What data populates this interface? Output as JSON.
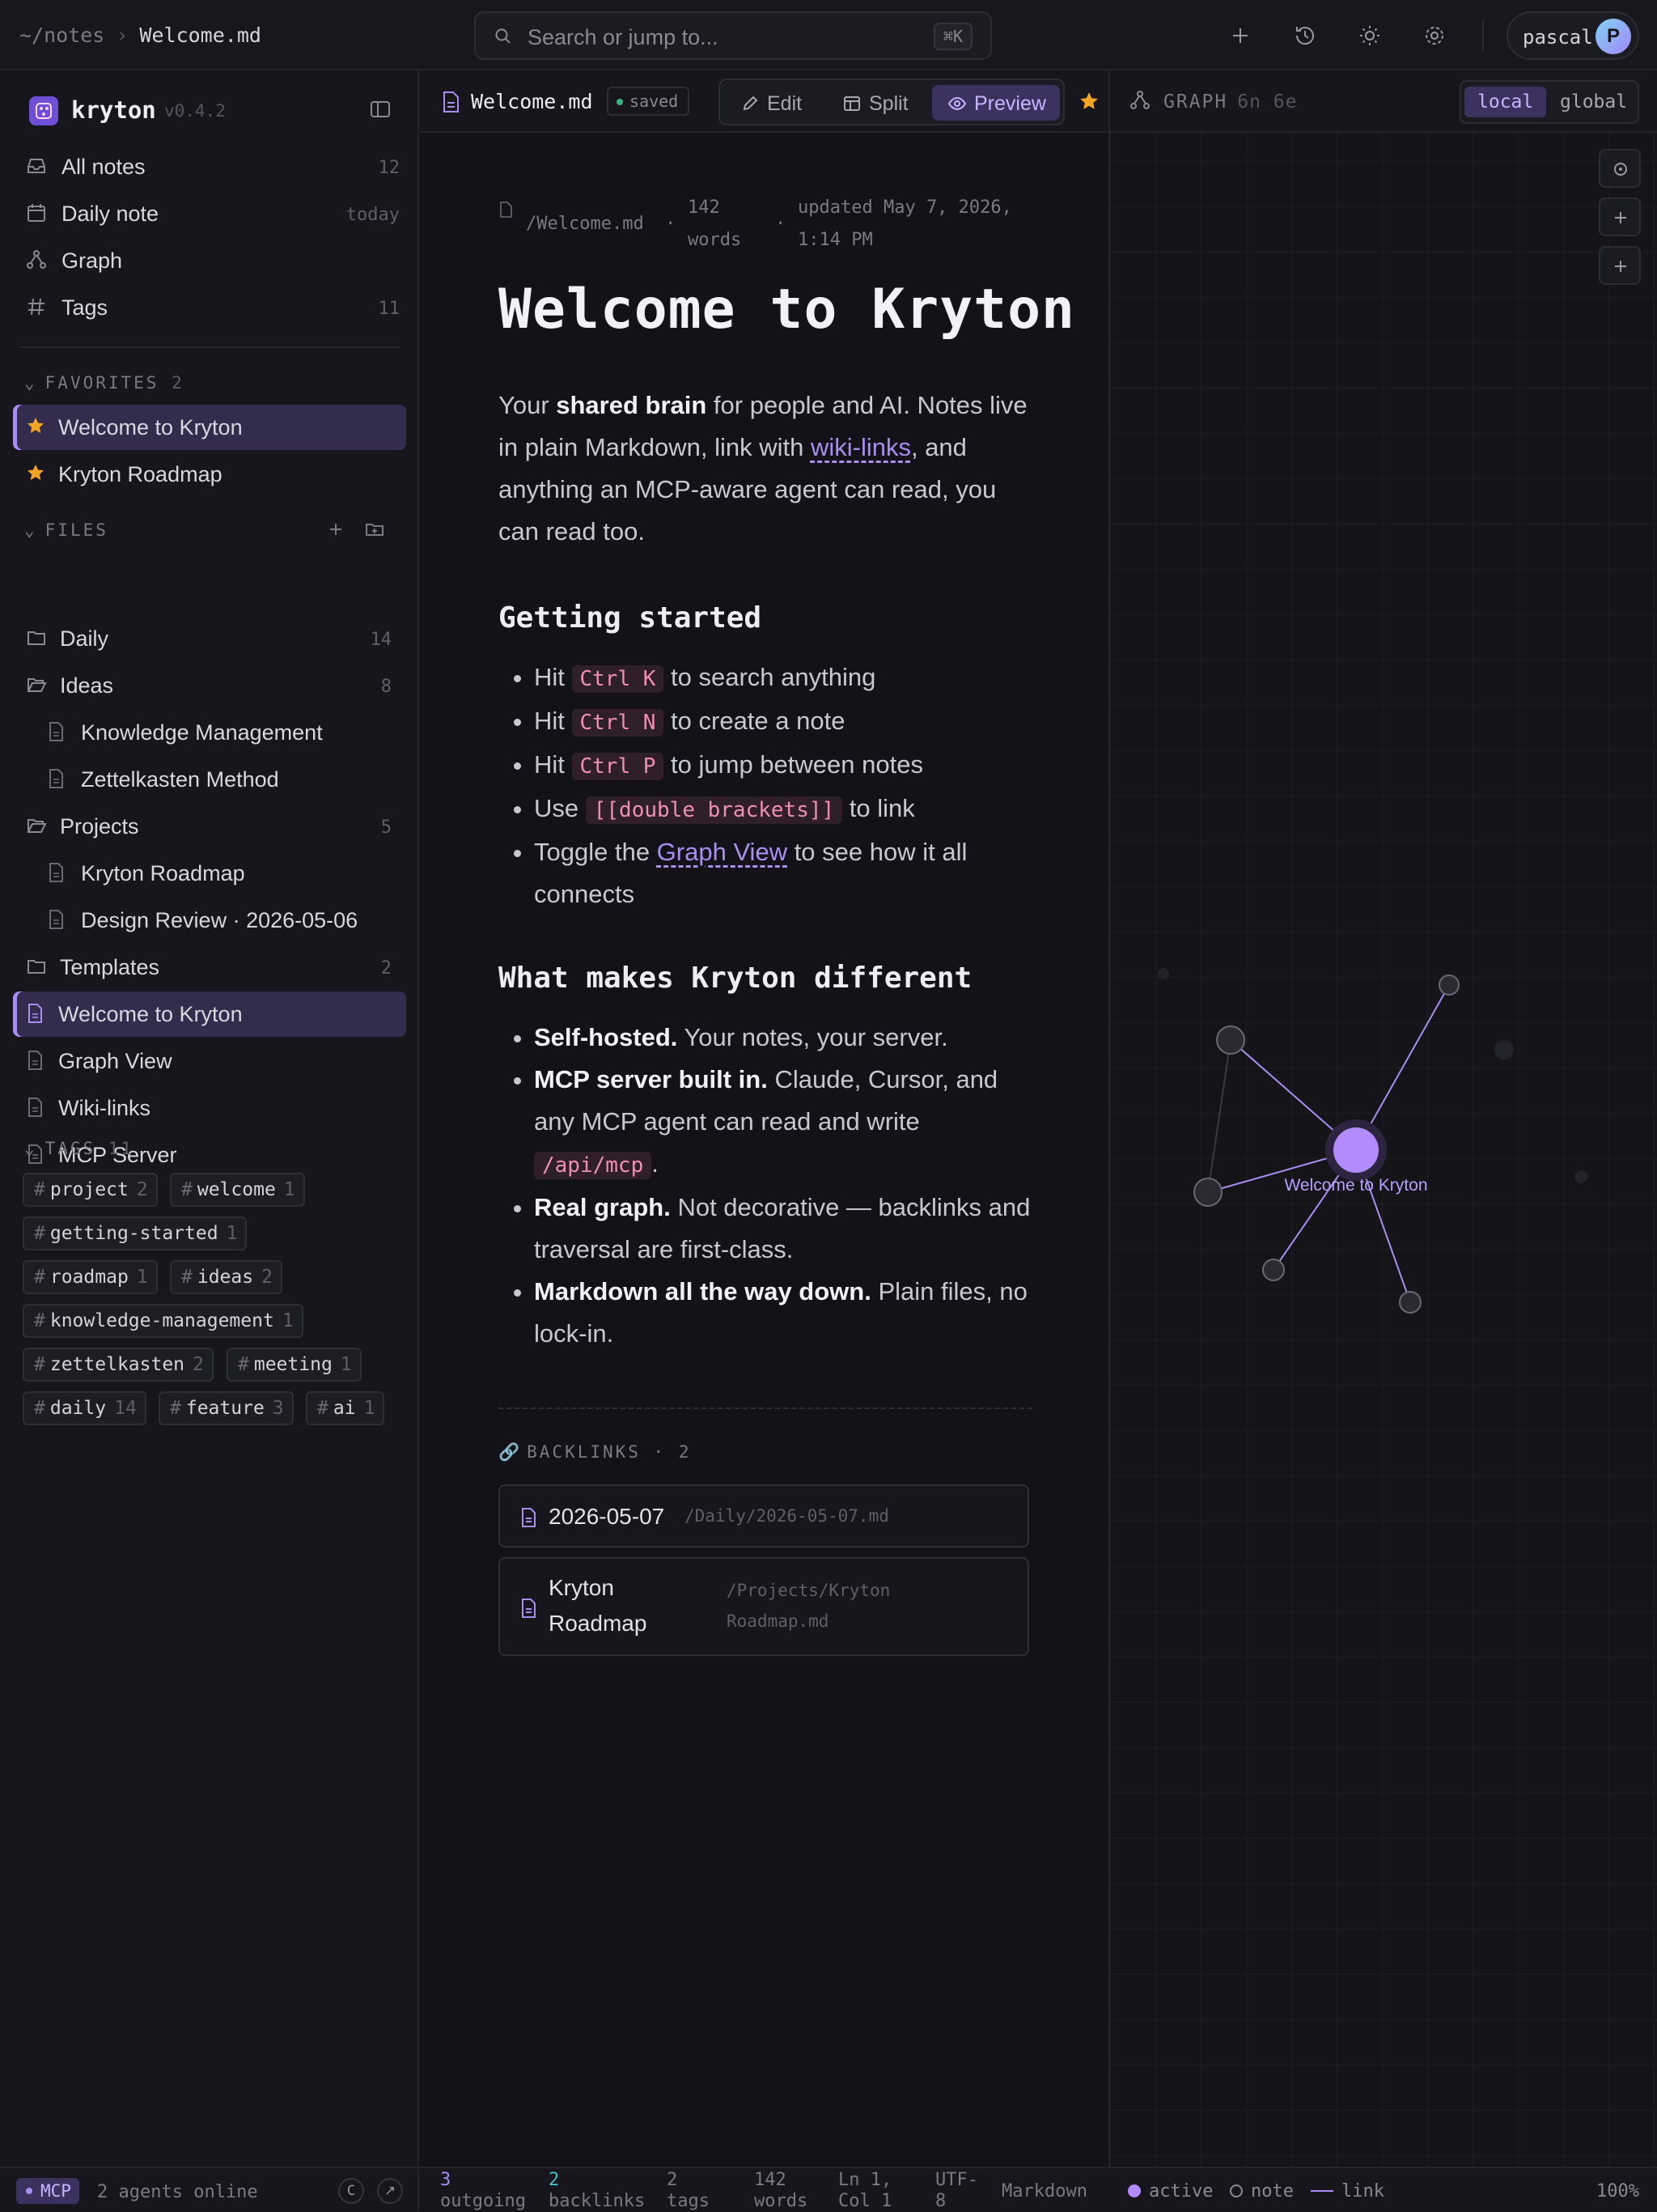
{
  "breadcrumb": {
    "root": "~/notes",
    "current": "Welcome.md"
  },
  "search": {
    "placeholder": "Search or jump to...",
    "shortcut": "⌘K"
  },
  "user": {
    "name": "pascal",
    "initial": "P"
  },
  "app": {
    "name": "kryton",
    "version": "v0.4.2"
  },
  "nav": [
    {
      "label": "All notes",
      "count": "12",
      "icon": "inbox-icon"
    },
    {
      "label": "Daily note",
      "count": "today",
      "icon": "calendar-icon"
    },
    {
      "label": "Graph",
      "count": "",
      "icon": "graph-icon"
    },
    {
      "label": "Tags",
      "count": "11",
      "icon": "hash-icon"
    }
  ],
  "favorites": {
    "title": "FAVORITES",
    "count": "2",
    "items": [
      "Welcome to Kryton",
      "Kryton Roadmap"
    ]
  },
  "files": {
    "title": "FILES",
    "tree": [
      {
        "label": "Daily",
        "count": "14",
        "type": "folder"
      },
      {
        "label": "Ideas",
        "count": "8",
        "type": "folder-open"
      },
      {
        "label": "Knowledge Management",
        "count": "",
        "type": "file-nested"
      },
      {
        "label": "Zettelkasten Method",
        "count": "",
        "type": "file-nested"
      },
      {
        "label": "Projects",
        "count": "5",
        "type": "folder-open"
      },
      {
        "label": "Kryton Roadmap",
        "count": "",
        "type": "file-nested"
      },
      {
        "label": "Design Review · 2026-05-06",
        "count": "",
        "type": "file-nested"
      },
      {
        "label": "Templates",
        "count": "2",
        "type": "folder"
      },
      {
        "label": "Welcome to Kryton",
        "count": "",
        "type": "file-active"
      },
      {
        "label": "Graph View",
        "count": "",
        "type": "file"
      },
      {
        "label": "Wiki-links",
        "count": "",
        "type": "file"
      },
      {
        "label": "MCP Server",
        "count": "",
        "type": "file"
      }
    ]
  },
  "tags": {
    "title": "TAGS",
    "count": "11",
    "items": [
      {
        "name": "project",
        "count": "2"
      },
      {
        "name": "welcome",
        "count": "1"
      },
      {
        "name": "getting-started",
        "count": "1"
      },
      {
        "name": "roadmap",
        "count": "1"
      },
      {
        "name": "ideas",
        "count": "2"
      },
      {
        "name": "knowledge-management",
        "count": "1"
      },
      {
        "name": "zettelkasten",
        "count": "2"
      },
      {
        "name": "meeting",
        "count": "1"
      },
      {
        "name": "daily",
        "count": "14"
      },
      {
        "name": "feature",
        "count": "3"
      },
      {
        "name": "ai",
        "count": "1"
      }
    ]
  },
  "sidebar_footer": {
    "badge": "MCP",
    "status": "2 agents online",
    "btn1": "C",
    "btn2": "↗"
  },
  "editor": {
    "tab": "Welcome.md",
    "saved": "saved",
    "modes": [
      "Edit",
      "Split",
      "Preview"
    ],
    "meta": {
      "path": "/Welcome.md",
      "words_line1": "142",
      "words_line2": "words",
      "updated_line1": "updated May 7, 2026,",
      "updated_line2": "1:14 PM"
    },
    "title": "Welcome to Kryton",
    "intro": {
      "a": "Your ",
      "b": "shared brain",
      "c": " for people and AI. Notes live in plain Markdown, link with ",
      "link": "wiki-links",
      "d": ", and anything an MCP-aware agent can read, you can read too."
    },
    "h_getting_started": "Getting started",
    "getting_started": [
      {
        "pre": "Hit ",
        "code": "Ctrl K",
        "post": " to search anything"
      },
      {
        "pre": "Hit ",
        "code": "Ctrl N",
        "post": " to create a note"
      },
      {
        "pre": "Hit ",
        "code": "Ctrl P",
        "post": " to jump between notes"
      },
      {
        "pre": "Use ",
        "code": "[[double brackets]]",
        "post": " to link"
      }
    ],
    "gs_last": {
      "pre": "Toggle the ",
      "link": "Graph View",
      "post": " to see how it all connects"
    },
    "h_different": "What makes Kryton different",
    "different": [
      {
        "b": "Self-hosted.",
        "t": " Your notes, your server."
      },
      {
        "b": "MCP server built in.",
        "t": " Claude, Cursor, and any MCP agent can read and write ",
        "code": "/api/mcp",
        "t2": "."
      },
      {
        "b": "Real graph.",
        "t": " Not decorative — backlinks and traversal are first-class."
      },
      {
        "b": "Markdown all the way down.",
        "t": " Plain files, no lock-in."
      }
    ],
    "backlinks": {
      "title": "BACKLINKS",
      "count": "2",
      "items": [
        {
          "name": "2026-05-07",
          "path": "/Daily/2026-05-07.md"
        },
        {
          "name_1": "Kryton",
          "name_2": "Roadmap",
          "path_1": "/Projects/Kryton",
          "path_2": "Roadmap.md"
        }
      ]
    }
  },
  "status": {
    "outgoing": {
      "value": "3",
      "label": "outgoing"
    },
    "backlinks": {
      "value": "2",
      "label": "backlinks"
    },
    "tags": {
      "value": "2",
      "label": "tags"
    },
    "words": {
      "value": "142",
      "label": "words"
    },
    "cursor": {
      "line1": "Ln 1,",
      "line2": "Col 1"
    },
    "encoding": {
      "line1": "UTF-",
      "line2": "8"
    },
    "language": "Markdown"
  },
  "graph": {
    "title": "GRAPH",
    "stats": "6n 6e",
    "scopes": [
      "local",
      "global"
    ],
    "active_scope": "local",
    "center_label": "Welcome to Kryton",
    "legend": [
      "active",
      "note",
      "link"
    ],
    "zoom": "100%",
    "colors": {
      "accent": "#a98df0",
      "active_node": "#b28cff",
      "note_node": "#2a2a33"
    }
  }
}
